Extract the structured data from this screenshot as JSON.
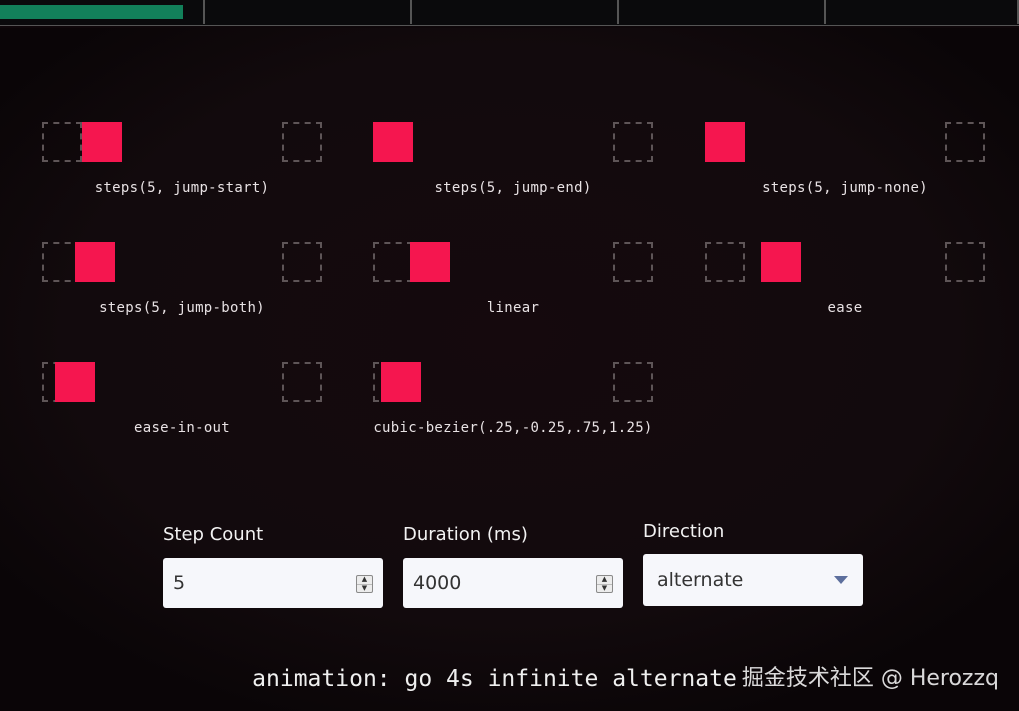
{
  "progress_segments": [
    {
      "fill": 0.9
    },
    {
      "fill": 0
    },
    {
      "fill": 0
    },
    {
      "fill": 0
    },
    {
      "fill": 0
    }
  ],
  "demos": [
    {
      "label": "steps(5, jump-start)",
      "progress": 0.2,
      "faded": false
    },
    {
      "label": "steps(5, jump-end)",
      "progress": 0.0,
      "faded": false
    },
    {
      "label": "steps(5, jump-none)",
      "progress": 0.0,
      "faded": false
    },
    {
      "label": "steps(5, jump-both)",
      "progress": 0.167,
      "faded": false
    },
    {
      "label": "linear",
      "progress": 0.187,
      "faded": false
    },
    {
      "label": "ease",
      "progress": 0.279,
      "faded": false
    },
    {
      "label": "ease-in-out",
      "progress": 0.067,
      "faded": false
    },
    {
      "label": "cubic-bezier(.25,-0.25,.75,1.25)",
      "progress": 0.04,
      "faded": false
    }
  ],
  "controls": {
    "step_count": {
      "label": "Step Count",
      "value": "5"
    },
    "duration": {
      "label": "Duration (ms)",
      "value": "4000"
    },
    "direction": {
      "label": "Direction",
      "value": "alternate",
      "options": [
        "alternate"
      ]
    }
  },
  "css_output": "animation: go 4s infinite alternate",
  "watermark": "掘金技术社区 @ Herozzq",
  "colors": {
    "mover": "#f5164f",
    "progress_fill": "#12805a",
    "background": "#0e070a"
  }
}
